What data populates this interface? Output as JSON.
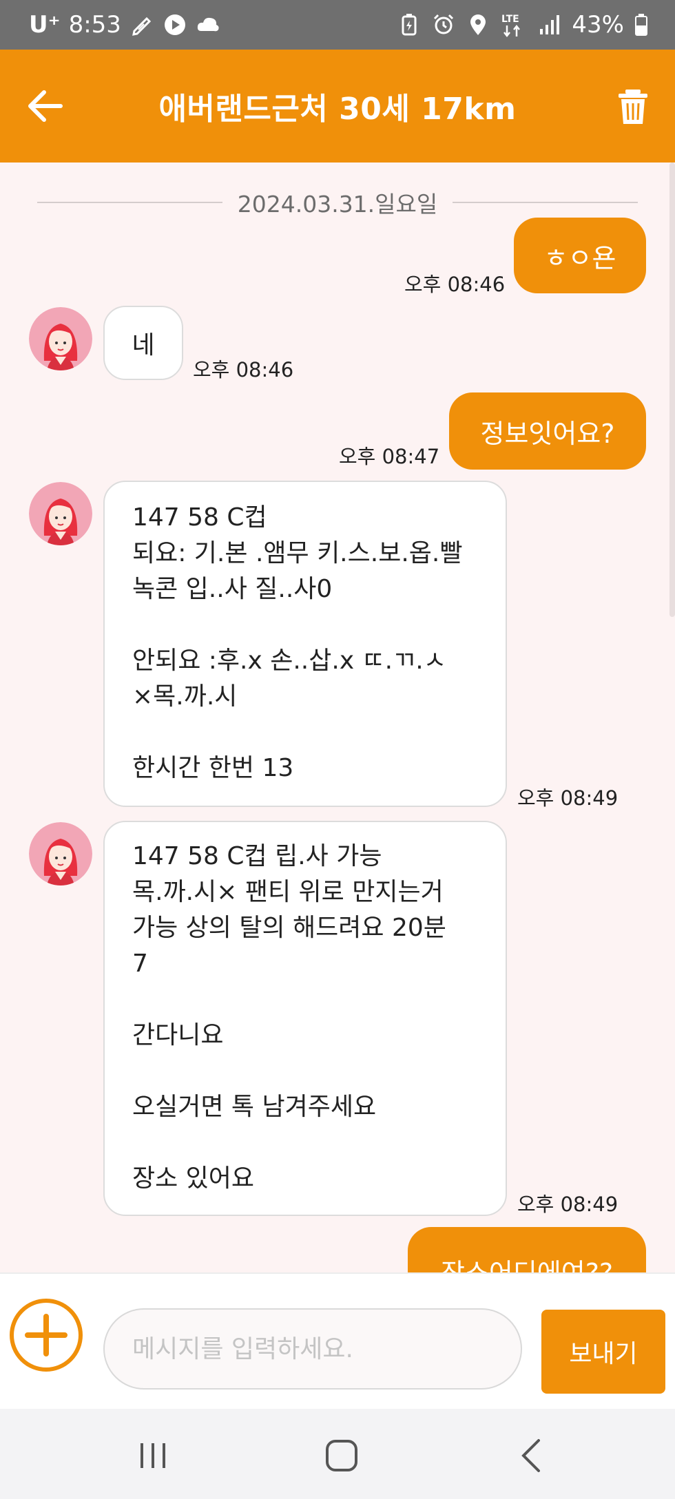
{
  "status_bar": {
    "carrier": "U⁺",
    "time": "8:53",
    "network": "LTE",
    "battery": "43%",
    "left_icons": [
      "pencil-icon",
      "play-icon",
      "cloud-icon"
    ],
    "right_icons": [
      "battery-saver-icon",
      "alarm-icon",
      "location-icon",
      "lte-icon",
      "signal-icon",
      "battery-icon"
    ]
  },
  "header": {
    "title": "애버랜드근처 30세 17km",
    "back_icon": "back-arrow-icon",
    "delete_icon": "trash-icon"
  },
  "chat": {
    "date": "2024.03.31.일요일",
    "messages": [
      {
        "dir": "out",
        "text": "ㅎㅇ욘",
        "time": "오후 08:46"
      },
      {
        "dir": "in",
        "text": "네",
        "time": "오후 08:46"
      },
      {
        "dir": "out",
        "text": "정보잇어요?",
        "time": "오후 08:47"
      },
      {
        "dir": "in",
        "text": "147 58  C컵\n되요: 기.본 .앰무 키.스.보.옵.빨\n녹콘 입..사 질..사0\n\n안되요 :후.x 손..삽.x ㄸ.ㄲ.ㅅ\n×목.까.시\n\n 한시간 한번 13",
        "time": "오후 08:49"
      },
      {
        "dir": "in",
        "text": "147 58  C컵 립.사 가능\n목.까.시× 팬티  위로 만지는거\n가능 상의 탈의 해드려요 20분\n7\n\n간다니요\n\n오실거면 톡 남겨주세요\n\n장소 있어요",
        "time": "오후 08:49"
      },
      {
        "dir": "out",
        "text": "장소어디에여??",
        "time": ""
      }
    ]
  },
  "input": {
    "placeholder": "메시지를 입력하세요.",
    "value": "",
    "send_label": "보내기",
    "plus_icon": "plus-circle-icon"
  },
  "nav_bar": {
    "icons": [
      "recent-apps-icon",
      "home-icon",
      "back-icon"
    ]
  },
  "colors": {
    "accent": "#f0900a",
    "status_bar": "#6f6f6f",
    "chat_background": "#fdf3f3"
  }
}
